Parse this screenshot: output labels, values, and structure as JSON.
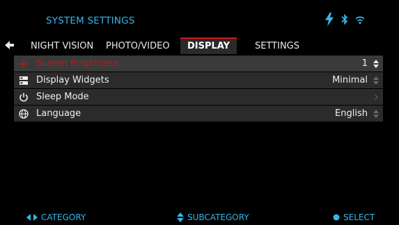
{
  "header": {
    "title": "SYSTEM SETTINGS",
    "icons": [
      "power-bolt-icon",
      "bluetooth-icon",
      "wifi-icon"
    ]
  },
  "tabs": [
    {
      "label": "NIGHT VISION",
      "active": false
    },
    {
      "label": "PHOTO/VIDEO",
      "active": false
    },
    {
      "label": "DISPLAY",
      "active": true
    },
    {
      "label": "SETTINGS",
      "active": false
    }
  ],
  "menu": {
    "items": [
      {
        "label": "Screen Brightness",
        "value": "1",
        "icon": "brightness-icon",
        "control": "up-down-arrows-icon",
        "selected": true
      },
      {
        "label": "Display Widgets",
        "value": "Minimal",
        "icon": "widgets-icon",
        "control": "up-down-arrows-icon"
      },
      {
        "label": "Sleep Mode",
        "value": "",
        "icon": "power-icon",
        "control": "chevron-right-icon"
      },
      {
        "label": "Language",
        "value": "English",
        "icon": "globe-icon",
        "control": "up-down-arrows-icon"
      }
    ]
  },
  "footer": {
    "category": "CATEGORY",
    "subcategory": "SUBCATEGORY",
    "select": "SELECT"
  },
  "colors": {
    "accent": "#35b6ec",
    "highlight_text": "#c01818",
    "tab_underline": "#d11a1a",
    "row_bg": "#2b2b2b"
  }
}
